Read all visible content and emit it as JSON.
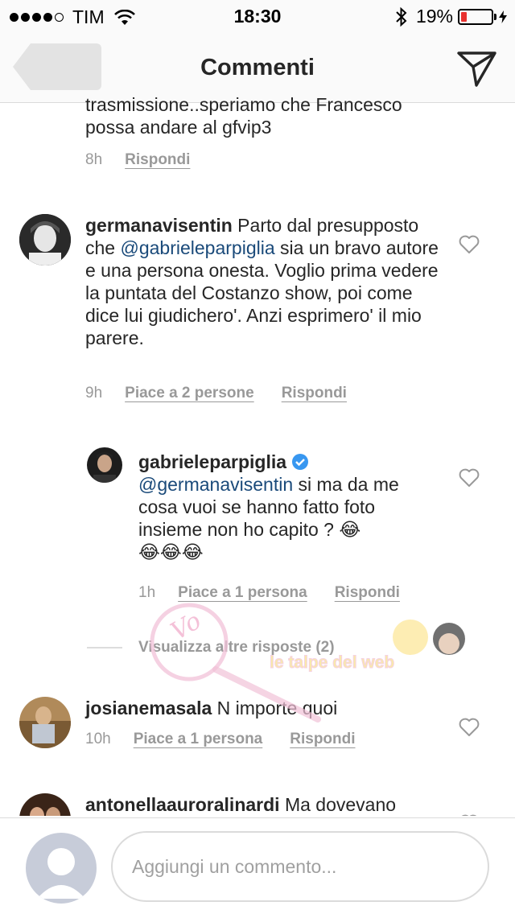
{
  "status_bar": {
    "carrier": "TIM",
    "time": "18:30",
    "battery_percent": "19%",
    "battery_level": 0.19,
    "signal_bars_filled": 4,
    "signal_bars_total": 5
  },
  "nav": {
    "title": "Commenti",
    "back_icon": "back-arrow-icon",
    "send_icon": "paper-plane-icon"
  },
  "comments": [
    {
      "text_tail": "trasmissione..speriamo che Francesco possa andare al gfvip3",
      "time": "8h",
      "reply_label": "Rispondi"
    },
    {
      "username": "germanavisentin",
      "text_before": " Parto dal presupposto che ",
      "mention": "@gabrieleparpiglia",
      "text_after": " sia un bravo autore e una persona onesta. Voglio prima vedere la puntata del Costanzo show, poi come dice lui giudichero'. Anzi esprimero' il mio parere.",
      "time": "9h",
      "likes_label": "Piace a 2 persone",
      "reply_label": "Rispondi"
    },
    {
      "username": "gabrieleparpiglia",
      "verified": true,
      "mention": "@germanavisentin",
      "text_after": " si ma da me cosa vuoi se hanno fatto foto insieme non ho capito ? 😂",
      "emoji_line": "😂😂😂",
      "time": "1h",
      "likes_label": "Piace a 1 persona",
      "reply_label": "Rispondi"
    },
    {
      "username": "josianemasala",
      "text_after": " N importe quoi",
      "time": "10h",
      "likes_label": "Piace a 1 persona",
      "reply_label": "Rispondi"
    },
    {
      "username": "antonellaauroralinardi",
      "text_after": " Ma dovevano"
    }
  ],
  "view_more_replies": "Visualizza altre risposte (2)",
  "composer": {
    "placeholder": "Aggiungi un commento..."
  },
  "colors": {
    "mention": "#1a4a7a",
    "verified_badge": "#3897f0",
    "battery_low": "#e8312f",
    "meta_gray": "#999999"
  }
}
